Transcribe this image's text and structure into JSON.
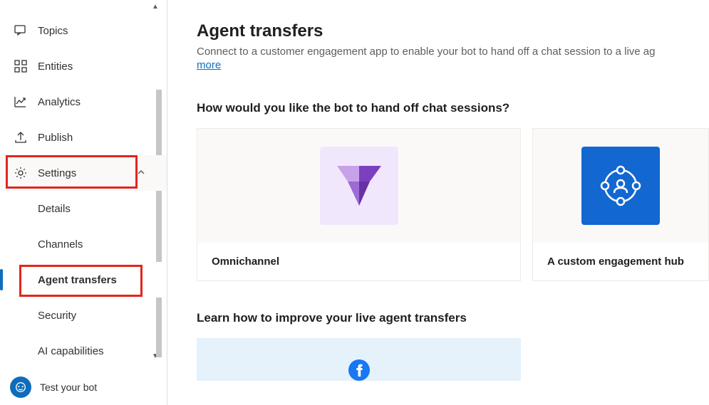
{
  "sidebar": {
    "items": [
      {
        "label": "Topics",
        "icon": "topics"
      },
      {
        "label": "Entities",
        "icon": "entities"
      },
      {
        "label": "Analytics",
        "icon": "analytics"
      },
      {
        "label": "Publish",
        "icon": "publish"
      },
      {
        "label": "Settings",
        "icon": "settings",
        "expanded": true,
        "children": [
          {
            "label": "Details"
          },
          {
            "label": "Channels"
          },
          {
            "label": "Agent transfers",
            "active": true
          },
          {
            "label": "Security"
          },
          {
            "label": "AI capabilities"
          }
        ]
      }
    ],
    "footer": {
      "label": "Test your bot"
    }
  },
  "main": {
    "title": "Agent transfers",
    "subtitle": "Connect to a customer engagement app to enable your bot to hand off a chat session to a live ag",
    "learn_more": "more",
    "handoff_heading": "How would you like the bot to hand off chat sessions?",
    "cards": [
      {
        "title": "Omnichannel"
      },
      {
        "title": "A custom engagement hub"
      }
    ],
    "improve_heading": "Learn how to improve your live agent transfers"
  }
}
